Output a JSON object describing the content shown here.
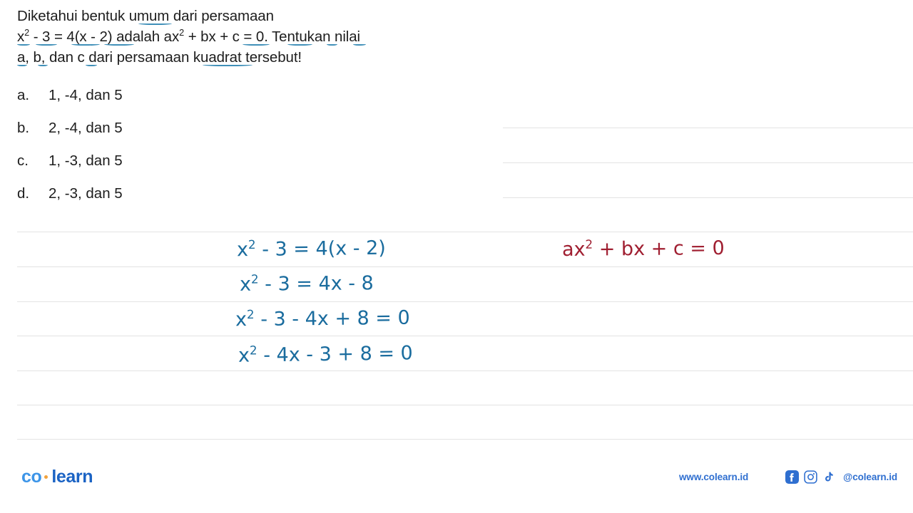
{
  "page": {
    "background": "#ffffff",
    "rule_color": "#e3e3e3"
  },
  "question": {
    "line1": "Diketahui bentuk umum dari persamaan",
    "line2_a": "x",
    "line2_sup": "2",
    "line2_b": " - 3 = 4(x - 2) adalah ax",
    "line2_sup2": "2",
    "line2_c": " + bx + c = 0. Tentukan nilai",
    "line3": "a, b, dan c dari persamaan kuadrat tersebut!"
  },
  "options": [
    {
      "letter": "a.",
      "text": "1, -4, dan 5"
    },
    {
      "letter": "b.",
      "text": "2, -4, dan 5"
    },
    {
      "letter": "c.",
      "text": "1, -3, dan 5"
    },
    {
      "letter": "d.",
      "text": "2, -3, dan 5"
    }
  ],
  "handwriting": {
    "color_blue": "#1a6c9e",
    "color_red": "#a01f31",
    "blue_lines": [
      {
        "pre": "x",
        "sup": "2",
        "post": " - 3 = 4(x - 2)"
      },
      {
        "pre": "x",
        "sup": "2",
        "post": " - 3 = 4x - 8"
      },
      {
        "pre": "x",
        "sup": "2",
        "post": " - 3 - 4x + 8 = 0"
      },
      {
        "pre": "x",
        "sup": "2",
        "post": " - 4x - 3 + 8 = 0"
      }
    ],
    "red_line": {
      "pre": "ax",
      "sup": "2",
      "post": " + bx + c = 0"
    }
  },
  "footer": {
    "logo_co": "co",
    "logo_learn": "learn",
    "site_url": "www.colearn.id",
    "handle": "@colearn.id",
    "social": [
      {
        "name": "facebook-icon"
      },
      {
        "name": "instagram-icon"
      },
      {
        "name": "tiktok-icon"
      }
    ],
    "brand_blue": "#2f6fd0",
    "logo_dot_color": "#f2a33c"
  }
}
